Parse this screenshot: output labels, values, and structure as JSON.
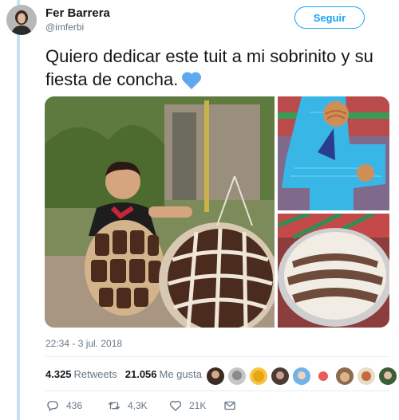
{
  "user": {
    "name": "Fer Barrera",
    "handle": "@imferbi"
  },
  "follow_label": "Seguir",
  "tweet": {
    "text": "Quiero dedicar este tuit a mi sobrinito y su fiesta de concha.",
    "emoji": "blue-heart-icon"
  },
  "timestamp": "22:34 - 3 jul. 2018",
  "stats": {
    "retweets_count": "4.325",
    "retweets_label": "Retweets",
    "likes_count": "21.056",
    "likes_label": "Me gusta"
  },
  "actions": {
    "reply_count": "436",
    "retweet_count": "4,3K",
    "like_count": "21K"
  },
  "colors": {
    "accent": "#1da1f2",
    "heart": "#5da9ee",
    "thread": "#c8e2f4"
  },
  "media": [
    "boy-concha-costume-photo",
    "blue-pinata-photo",
    "concha-cake-photo"
  ]
}
